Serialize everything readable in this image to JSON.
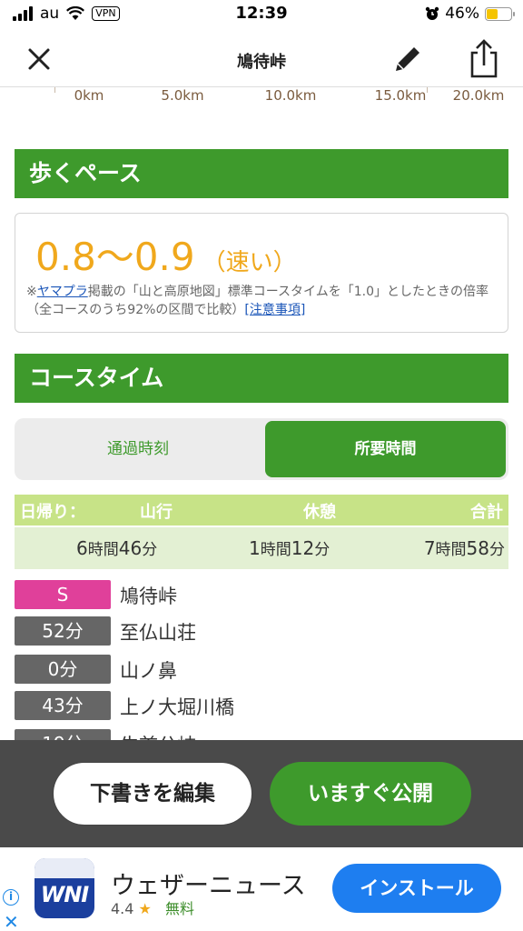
{
  "status_bar": {
    "carrier": "au",
    "vpn": "VPN",
    "time": "12:39",
    "battery": "46%",
    "battery_level": 0.46
  },
  "nav": {
    "title": "鳩待峠"
  },
  "distance_axis": [
    "0km",
    "5.0km",
    "10.0km",
    "15.0km",
    "20.0km"
  ],
  "pace": {
    "header": "歩くペース",
    "value": "0.8〜0.9",
    "grade": "（速い）",
    "note_mark": "※",
    "note_link": "ヤマプラ",
    "note_text": "掲載の「山と高原地図」標準コースタイムを「1.0」としたときの倍率（全コースのうち92%の区間で比較）",
    "note_caution": "[注意事項]"
  },
  "course_time": {
    "header": "コースタイム",
    "tabs": [
      {
        "label": "通過時刻",
        "active": false
      },
      {
        "label": "所要時間",
        "active": true
      }
    ],
    "summary_head": {
      "trip": "日帰り：",
      "walk": "山行",
      "rest": "休憩",
      "total": "合計"
    },
    "summary": {
      "walk_h": "6",
      "walk_m": "46",
      "rest_h": "1",
      "rest_m": "12",
      "total_h": "7",
      "total_m": "58",
      "unit_h": "時間",
      "unit_m": "分"
    },
    "waypoints": [
      {
        "badge": "S",
        "name": "鳩待峠",
        "color": "#e0409a"
      },
      {
        "badge": "52分",
        "name": "至仏山荘",
        "color": "#666666"
      },
      {
        "badge": "0分",
        "name": "山ノ鼻",
        "color": "#666666"
      },
      {
        "badge": "43分",
        "name": "上ノ大堀川橋",
        "color": "#666666"
      },
      {
        "badge": "19分",
        "name": "牛首分岐",
        "color": "#666666"
      }
    ]
  },
  "actions": {
    "draft": "下書きを編集",
    "publish": "いますぐ公開"
  },
  "ad": {
    "info": "i",
    "close": "✕",
    "logo": "WNI",
    "title": "ウェザーニュース",
    "rating": "4.4",
    "star": "★",
    "price": "無料",
    "install": "インストール"
  },
  "colors": {
    "green": "#3e9a2c",
    "pace": "#f0a81c",
    "start": "#e0409a",
    "badge": "#666666"
  }
}
